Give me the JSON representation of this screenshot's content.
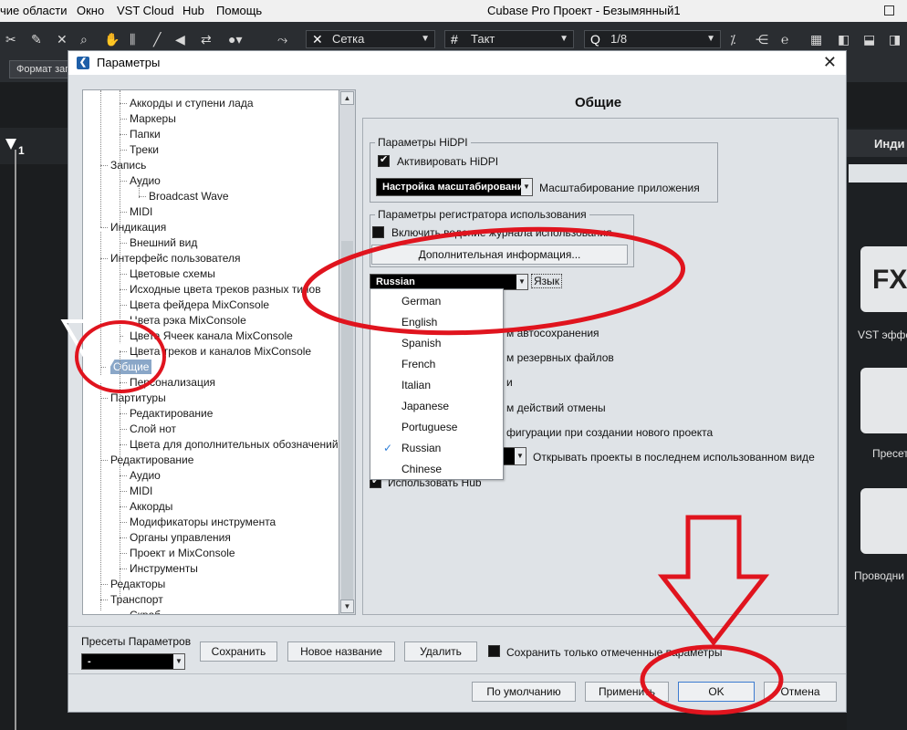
{
  "menubar": {
    "items": [
      "чие области",
      "Окно",
      "VST Cloud",
      "Hub",
      "Помощь"
    ],
    "app_title": "Cubase Pro Проект - Безымянный1"
  },
  "toolbar": {
    "grid_label": "Сетка",
    "meter_label": "Такт",
    "quantize_value": "1/8",
    "format_button": "Формат зап"
  },
  "ruler": {
    "bar_number": "1"
  },
  "right_panel": {
    "header": "Инди",
    "tiles": [
      "VST эффе",
      "Пресет",
      "Проводни"
    ],
    "fx_text": "FX"
  },
  "dialog": {
    "title": "Параметры",
    "page_title": "Общие",
    "tree": [
      {
        "label": "Аккорды и ступени лада",
        "level": 2
      },
      {
        "label": "Маркеры",
        "level": 2
      },
      {
        "label": "Папки",
        "level": 2
      },
      {
        "label": "Треки",
        "level": 2
      },
      {
        "label": "Запись",
        "level": 1
      },
      {
        "label": "Аудио",
        "level": 2
      },
      {
        "label": "Broadcast Wave",
        "level": 3
      },
      {
        "label": "MIDI",
        "level": 2
      },
      {
        "label": "Индикация",
        "level": 1
      },
      {
        "label": "Внешний вид",
        "level": 2
      },
      {
        "label": "Интерфейс пользователя",
        "level": 1
      },
      {
        "label": "Цветовые схемы",
        "level": 2
      },
      {
        "label": "Исходные цвета треков разных типов",
        "level": 2
      },
      {
        "label": "Цвета фейдера MixConsole",
        "level": 2
      },
      {
        "label": "Цвета рэка MixConsole",
        "level": 2
      },
      {
        "label": "Цвета Ячеек канала MixConsole",
        "level": 2
      },
      {
        "label": "Цвета треков и каналов MixConsole",
        "level": 2
      },
      {
        "label": "Общие",
        "level": 1,
        "selected": true
      },
      {
        "label": "Персонализация",
        "level": 2
      },
      {
        "label": "Партитуры",
        "level": 1
      },
      {
        "label": "Редактирование",
        "level": 2
      },
      {
        "label": "Слой нот",
        "level": 2
      },
      {
        "label": "Цвета для дополнительных обозначений",
        "level": 2
      },
      {
        "label": "Редактирование",
        "level": 1
      },
      {
        "label": "Аудио",
        "level": 2
      },
      {
        "label": "MIDI",
        "level": 2
      },
      {
        "label": "Аккорды",
        "level": 2
      },
      {
        "label": "Модификаторы инструмента",
        "level": 2
      },
      {
        "label": "Органы управления",
        "level": 2
      },
      {
        "label": "Проект и MixConsole",
        "level": 2
      },
      {
        "label": "Инструменты",
        "level": 2
      },
      {
        "label": "Редакторы",
        "level": 1
      },
      {
        "label": "Транспорт",
        "level": 1
      },
      {
        "label": "Скраб",
        "level": 2
      }
    ],
    "hidpi": {
      "group_title": "Параметры HiDPI",
      "activate_label": "Активировать HiDPI",
      "scaling_select": "Настройка масштабирования",
      "scaling_label": "Масштабирование приложения"
    },
    "logger": {
      "group_title": "Параметры регистратора использования",
      "enable_label": "Включить ведение журнала использования",
      "more_info_button": "Дополнительная информация..."
    },
    "language": {
      "selected": "Russian",
      "label": "Язык",
      "options": [
        "German",
        "English",
        "Spanish",
        "French",
        "Italian",
        "Japanese",
        "Portuguese",
        "Russian",
        "Chinese"
      ],
      "checked_option": "Russian"
    },
    "partial_rows": [
      "м автосохранения",
      "м резервных файлов",
      "и",
      "м действий отмены",
      "фигурации при создании нового проекта"
    ],
    "open_projects_label": "Открывать проекты в последнем использованном виде",
    "use_hub_label": "Использовать Hub",
    "presets": {
      "label": "Пресеты Параметров",
      "select_value": "-",
      "save_button": "Сохранить",
      "new_name_button": "Новое название",
      "delete_button": "Удалить",
      "save_marked_label": "Сохранить только отмеченные параметры"
    },
    "buttons": {
      "default": "По умолчанию",
      "apply": "Применить",
      "ok": "OK",
      "cancel": "Отмена"
    }
  },
  "colors": {
    "annotation_red": "#e0141e",
    "selection": "#8aa7c8",
    "check_blue": "#2f7fd8"
  }
}
